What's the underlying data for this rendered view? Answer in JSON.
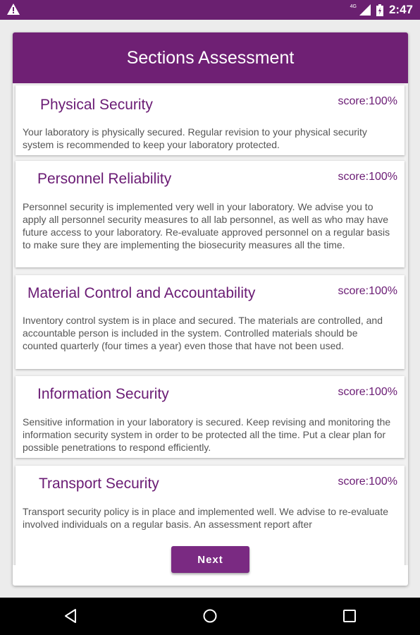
{
  "status_bar": {
    "time": "2:47",
    "network_label": "4G",
    "icons": [
      "warning-icon",
      "signal-icon",
      "battery-icon"
    ]
  },
  "header": {
    "title": "Sections Assessment"
  },
  "sections": [
    {
      "title": "Physical Security",
      "score": "score:100%",
      "description": "Your laboratory is physically secured. Regular revision to your physical security system is recommended to keep your laboratory protected."
    },
    {
      "title": "Personnel Reliability",
      "score": "score:100%",
      "description": "Personnel security is implemented very well in your laboratory. We advise you to apply all personnel security measures to all lab personnel, as well as who may have future access to your laboratory. Re-evaluate approved personnel on a regular basis to make sure they are implementing the biosecurity measures all the time."
    },
    {
      "title": "Material Control and Accountability",
      "score": "score:100%",
      "description": "Inventory control system is in place and secured. The materials are controlled, and accountable person is included in the system. Controlled materials should be counted quarterly (four times a year) even those that have not been used."
    },
    {
      "title": "Information Security",
      "score": "score:100%",
      "description": "Sensitive information in your laboratory is secured. Keep revising and monitoring the information security system in order to be protected all the time. Put a clear plan for possible penetrations to respond efficiently."
    },
    {
      "title": "Transport Security",
      "score": "score:100%",
      "description": "Transport security policy is in place and implemented well. We advise to re-evaluate involved individuals on a regular basis. An assessment report after"
    }
  ],
  "next_button": {
    "label": "Next"
  },
  "nav_bar": {
    "icons": [
      "back-icon",
      "home-icon",
      "recents-icon"
    ]
  },
  "colors": {
    "primary": "#6f2074",
    "accent_text": "#6a1b74",
    "status_bar": "#6a2070"
  }
}
